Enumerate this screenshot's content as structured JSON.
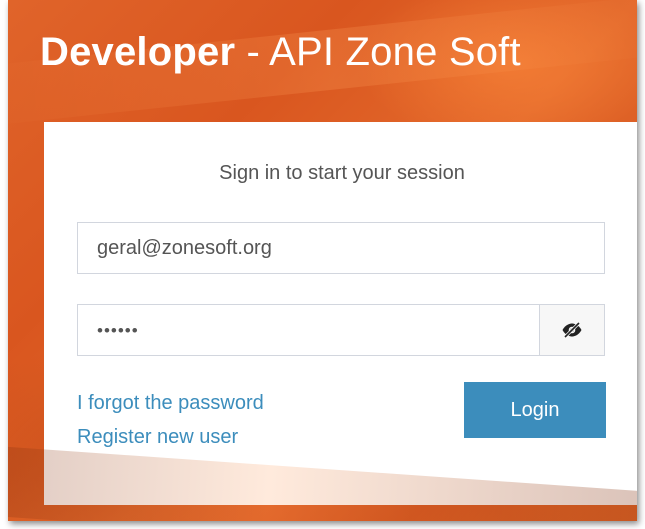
{
  "header": {
    "title_bold": "Developer",
    "title_rest": " - API Zone Soft"
  },
  "login_box": {
    "message": "Sign in to start your session",
    "email": {
      "value": "geral@zonesoft.org"
    },
    "password": {
      "masked_value": "••••••",
      "toggle_icon": "eye-slash-icon"
    },
    "forgot_password_label": "I forgot the password",
    "register_label": "Register new user",
    "login_label": "Login"
  },
  "colors": {
    "background": "#de5e25",
    "primary": "#3c8dbc",
    "link": "#3c8dbc",
    "card": "#ffffff"
  }
}
